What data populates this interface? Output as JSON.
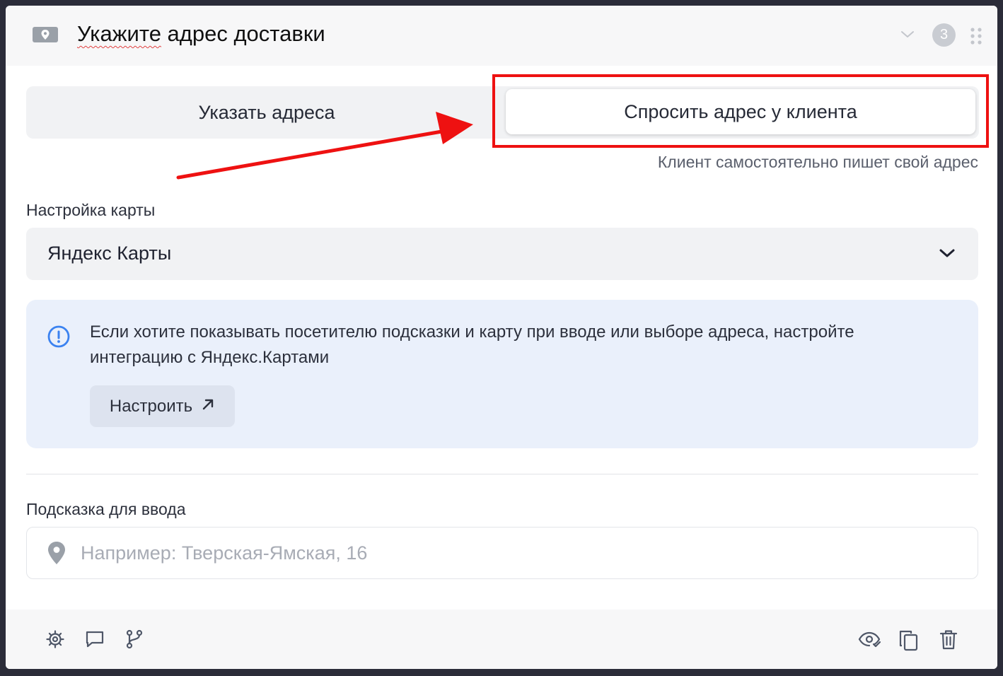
{
  "header": {
    "title_word1": "Укажите",
    "title_rest": " адрес доставки",
    "step_badge": "3",
    "icons": [
      "map-pin-icon",
      "chevron-down-icon",
      "drag-handle-icon"
    ]
  },
  "mode_selector": {
    "option_manual": "Указать адреса",
    "option_ask": "Спросить адрес у клиента",
    "selected": "option_ask",
    "hint": "Клиент самостоятельно пишет свой адрес"
  },
  "map_settings": {
    "label": "Настройка карты",
    "selected_value": "Яндекс Карты"
  },
  "info_box": {
    "text": "Если хотите показывать посетителю подсказки и карту при вводе или выборе адреса, настройте интеграцию с Яндекс.Картами",
    "button_label": "Настроить"
  },
  "input_hint": {
    "label": "Подсказка для ввода",
    "placeholder": "Например: Тверская-Ямская, 16"
  },
  "footer": {
    "left_icons": [
      "settings-icon",
      "comment-icon",
      "branch-icon"
    ],
    "right_icons": [
      "eye-check-icon",
      "copy-icon",
      "trash-icon"
    ]
  },
  "annotation": {
    "highlight_color": "#ee1111"
  }
}
